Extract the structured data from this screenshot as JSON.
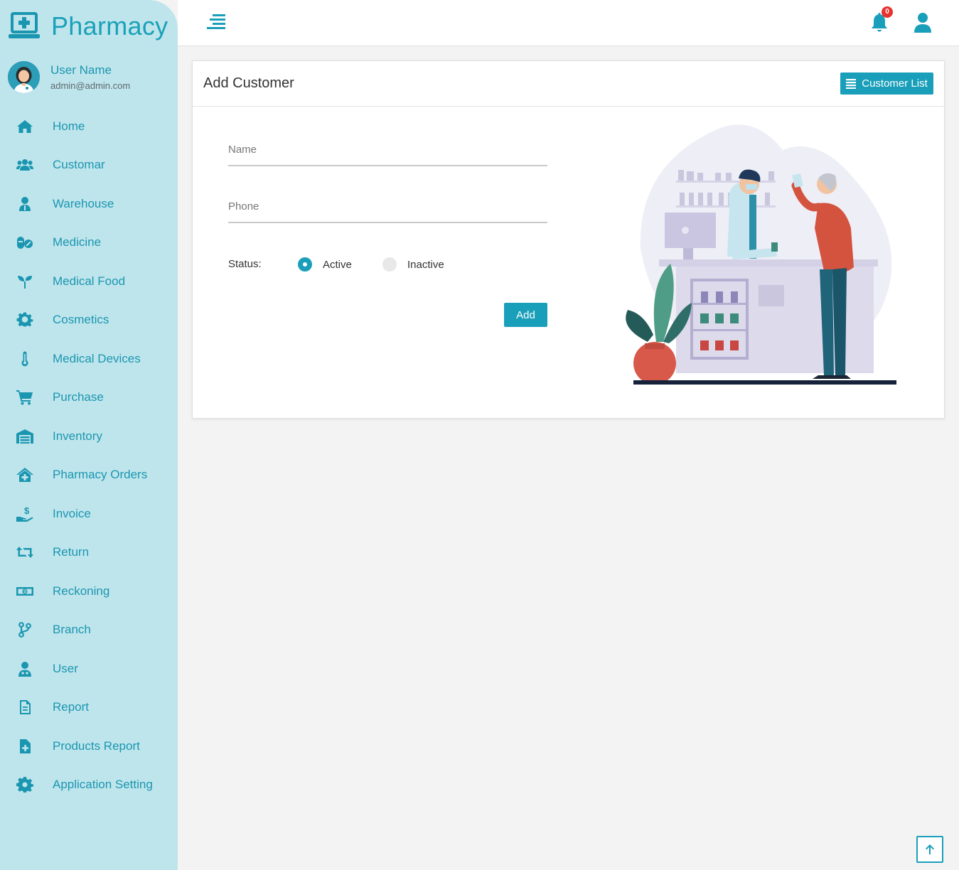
{
  "brand": {
    "title": "Pharmacy",
    "icon": "laptop-medical-icon"
  },
  "profile": {
    "name": "User Name",
    "email": "admin@admin.com"
  },
  "sidebar": {
    "items": [
      {
        "label": "Home",
        "icon": "home-icon"
      },
      {
        "label": "Customar",
        "icon": "users-icon"
      },
      {
        "label": "Warehouse",
        "icon": "user-tie-icon"
      },
      {
        "label": "Medicine",
        "icon": "pills-icon"
      },
      {
        "label": "Medical Food",
        "icon": "seedling-icon"
      },
      {
        "label": "Cosmetics",
        "icon": "gear-outline-icon"
      },
      {
        "label": "Medical Devices",
        "icon": "thermometer-icon"
      },
      {
        "label": "Purchase",
        "icon": "cart-icon"
      },
      {
        "label": "Inventory",
        "icon": "warehouse-icon"
      },
      {
        "label": "Pharmacy Orders",
        "icon": "clinic-icon"
      },
      {
        "label": "Invoice",
        "icon": "hand-dollar-icon"
      },
      {
        "label": "Return",
        "icon": "retweet-icon"
      },
      {
        "label": "Reckoning",
        "icon": "money-bill-icon"
      },
      {
        "label": "Branch",
        "icon": "code-branch-icon"
      },
      {
        "label": "User",
        "icon": "user-doctor-icon"
      },
      {
        "label": "Report",
        "icon": "file-icon"
      },
      {
        "label": "Products Report",
        "icon": "file-medical-icon"
      },
      {
        "label": "Application Setting",
        "icon": "cog-icon"
      }
    ]
  },
  "topbar": {
    "notification_count": "0"
  },
  "card": {
    "title": "Add Customer",
    "list_button": "Customer List"
  },
  "form": {
    "name_placeholder": "Name",
    "phone_placeholder": "Phone",
    "status_label": "Status:",
    "active_label": "Active",
    "inactive_label": "Inactive",
    "selected_status": "Active",
    "submit_label": "Add"
  },
  "colors": {
    "accent": "#1a9fba",
    "sidebar_bg": "#bfe5ec",
    "badge": "#e5322d"
  }
}
